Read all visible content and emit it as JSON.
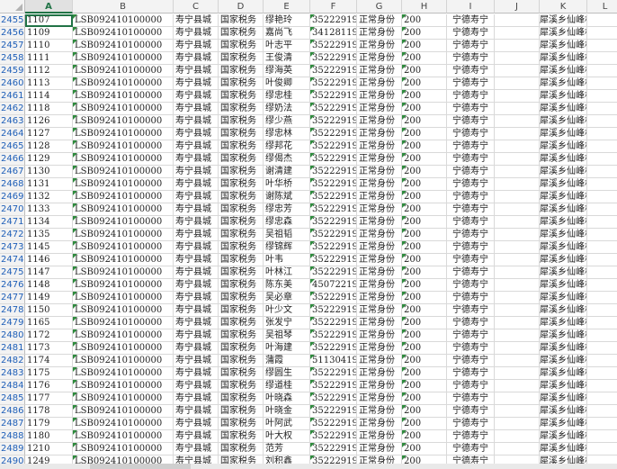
{
  "columns": [
    "A",
    "B",
    "C",
    "D",
    "E",
    "F",
    "G",
    "H",
    "I",
    "J",
    "K",
    "L"
  ],
  "selected_column": "A",
  "row_numbers": [
    "2455",
    "2456",
    "2457",
    "2458",
    "2459",
    "2460",
    "2461",
    "2462",
    "2463",
    "2464",
    "2465",
    "2466",
    "2467",
    "2468",
    "2469",
    "2470",
    "2471",
    "2472",
    "2473",
    "2474",
    "2475",
    "2476",
    "2477",
    "2478",
    "2479",
    "2480",
    "2481",
    "2482",
    "2483",
    "2484",
    "2485",
    "2486",
    "2487",
    "2488",
    "2489",
    "2490"
  ],
  "col_a": [
    "1107",
    "1109",
    "1110",
    "1111",
    "1112",
    "1113",
    "1114",
    "1118",
    "1126",
    "1127",
    "1128",
    "1129",
    "1130",
    "1131",
    "1132",
    "1133",
    "1134",
    "1135",
    "1145",
    "1146",
    "1147",
    "1148",
    "1149",
    "1150",
    "1165",
    "1172",
    "1173",
    "1174",
    "1175",
    "1176",
    "1177",
    "1178",
    "1179",
    "1180",
    "1210",
    "1249"
  ],
  "col_b": "LSB092410100000",
  "col_c": "寿宁县城",
  "col_d": "国家税务",
  "col_e": [
    "缪艳玲",
    "嘉尚飞",
    "叶志平",
    "王俊清",
    "缪海英",
    "叶俊卿",
    "缪忠桂",
    "缪奶法",
    "缪少燕",
    "缪忠林",
    "缪邦花",
    "缪偈杰",
    "谢清建",
    "叶华桥",
    "谢陈斌",
    "缪忠芳",
    "缪忠森",
    "吴祖韬",
    "缪锦辉",
    "叶韦",
    "叶林江",
    "陈东美",
    "吴必章",
    "叶少文",
    "张发宁",
    "吴祖琴",
    "叶海建",
    "蒲霞",
    "缪圆生",
    "缪道桂",
    "叶晓森",
    "叶晓金",
    "叶阿武",
    "叶大权",
    "范芳",
    "刘积鑫"
  ],
  "col_f": [
    "35222919",
    "34128119",
    "35222919",
    "35222919",
    "35222919",
    "35222919",
    "35222919",
    "35222919",
    "35222919",
    "35222919",
    "35222919",
    "35222919",
    "35222919",
    "35222919",
    "35222919",
    "35222919",
    "35222919",
    "35222919",
    "35222919",
    "35222919",
    "35222919",
    "45072219",
    "35222919",
    "35222919",
    "35222919",
    "35222919",
    "35222919",
    "51130419",
    "35222919",
    "35222919",
    "35222919",
    "35222919",
    "35222919",
    "35222919",
    "35222919",
    "35222919"
  ],
  "col_g": "正常身份",
  "col_h": "200",
  "col_i": "宁德寿宁",
  "col_k": "犀溪乡仙峰村"
}
